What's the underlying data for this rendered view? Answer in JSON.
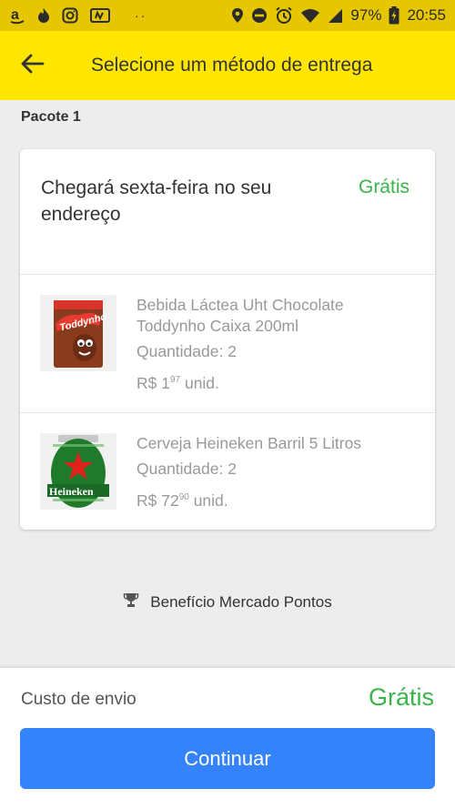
{
  "status_bar": {
    "battery": "97%",
    "time": "20:55",
    "dots": "··",
    "icons": [
      "amazon-icon",
      "flame-icon",
      "instagram-icon",
      "news-icon",
      "location-icon",
      "do-not-disturb-icon",
      "alarm-icon",
      "wifi-icon",
      "signal-icon",
      "battery-charging-icon"
    ]
  },
  "app_bar": {
    "title": "Selecione um método de entrega",
    "back_icon": "arrow-left-icon",
    "color": "#ffe600"
  },
  "package": {
    "label": "Pacote 1"
  },
  "delivery": {
    "text": "Chegará sexta-feira no seu endereço",
    "price": "Grátis"
  },
  "items": [
    {
      "name": "Bebida Láctea Uht Chocolate Toddynho Caixa 200ml",
      "quantity": "Quantidade: 2",
      "price_prefix": "R$ 1",
      "price_cents": "97",
      "price_suffix": " unid.",
      "thumb_label": "Toddynho"
    },
    {
      "name": "Cerveja Heineken Barril 5 Litros",
      "quantity": "Quantidade: 2",
      "price_prefix": "R$ 72",
      "price_cents": "90",
      "price_suffix": " unid.",
      "thumb_label": "Heineken"
    }
  ],
  "benefit": {
    "icon": "trophy-icon",
    "text": "Benefício Mercado Pontos"
  },
  "footer": {
    "shipping_label": "Custo de envio",
    "shipping_value": "Grátis",
    "continue_label": "Continuar",
    "button_color": "#3483fa",
    "accent_green": "#39b54a"
  }
}
